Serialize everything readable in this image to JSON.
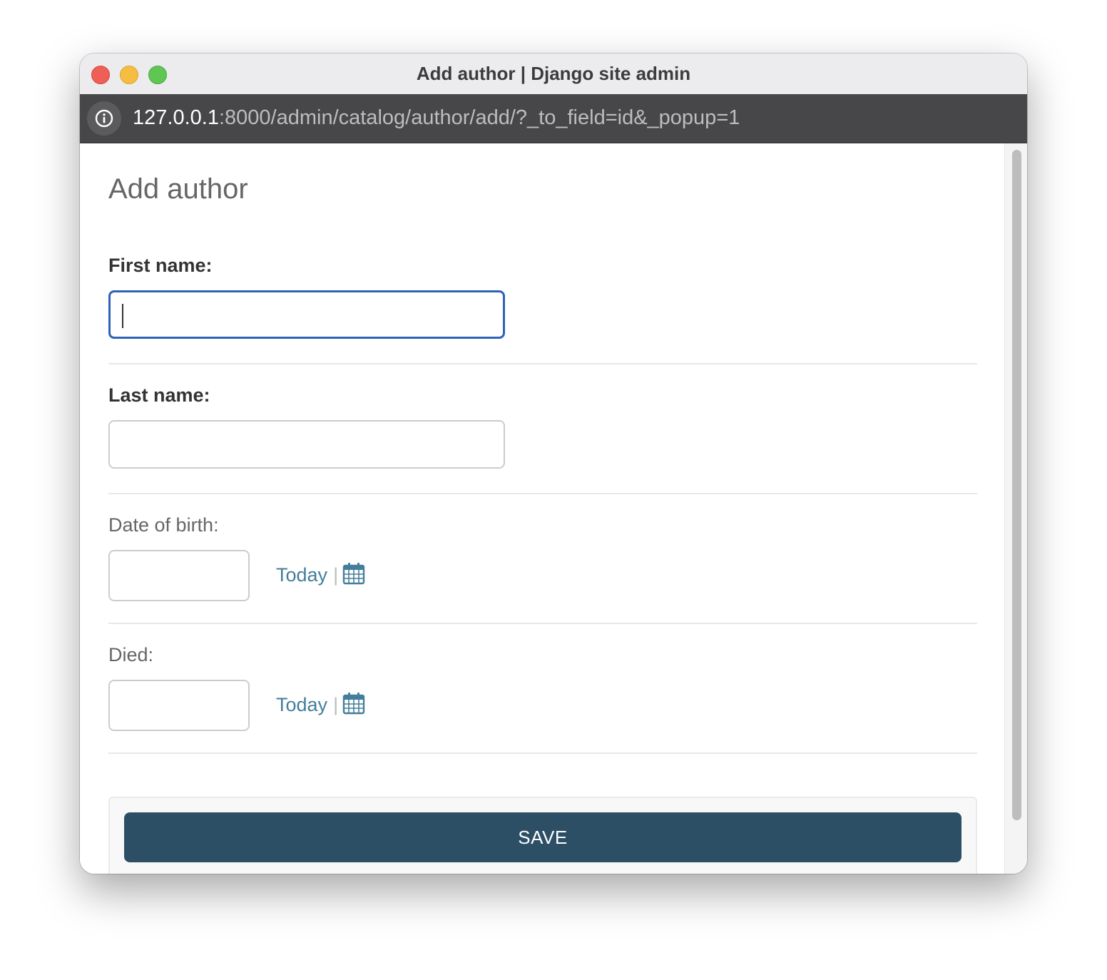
{
  "window": {
    "title": "Add author | Django site admin"
  },
  "address_bar": {
    "url_host": "127.0.0.1",
    "url_path": ":8000/admin/catalog/author/add/?_to_field=id&_popup=1",
    "info_icon": "info-icon"
  },
  "page": {
    "title": "Add author"
  },
  "form": {
    "first_name": {
      "label": "First name:",
      "value": "",
      "focused": true
    },
    "last_name": {
      "label": "Last name:",
      "value": ""
    },
    "date_of_birth": {
      "label": "Date of birth:",
      "value": "",
      "today_label": "Today",
      "separator": "|",
      "calendar_icon": "calendar-icon"
    },
    "died": {
      "label": "Died:",
      "value": "",
      "today_label": "Today",
      "separator": "|",
      "calendar_icon": "calendar-icon"
    }
  },
  "submit": {
    "save_label": "SAVE"
  },
  "colors": {
    "link": "#447e9b",
    "save_button": "#2c4f65",
    "focus_border": "#2f63b8",
    "address_bar": "#474749"
  }
}
